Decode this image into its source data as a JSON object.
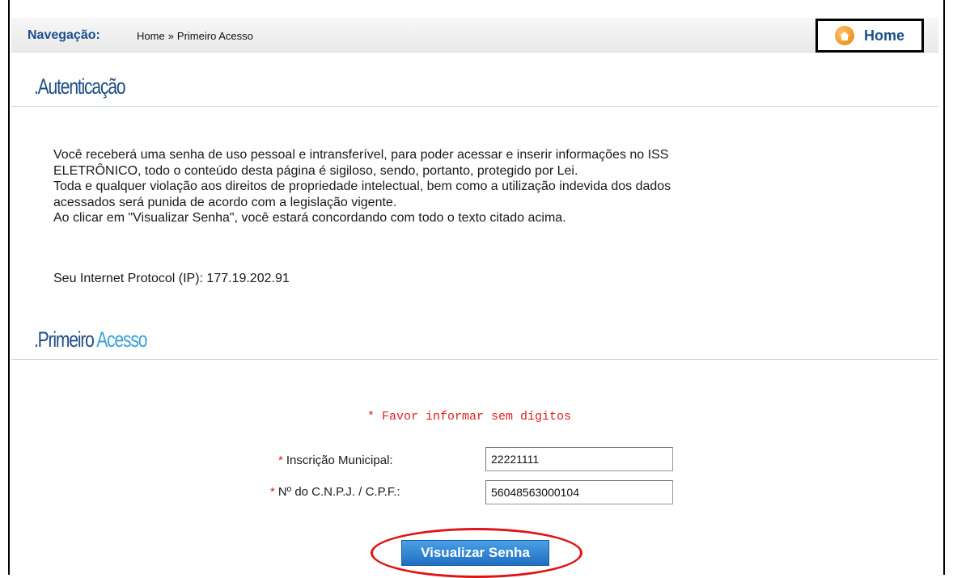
{
  "navigation": {
    "label": "Navegação:",
    "crumbs": [
      "Home",
      "Primeiro Acesso"
    ],
    "separator": "»",
    "home_button_label": "Home"
  },
  "sections": {
    "auth_title": ".Autenticação",
    "first_access_title_part1": ".Primeiro",
    "first_access_title_part2": "Acesso"
  },
  "auth": {
    "lines": [
      "Você receberá uma senha de uso pessoal e intransferível, para poder acessar e inserir informações no ISS",
      "ELETRÔNICO, todo o conteúdo desta página é sigiloso, sendo, portanto, protegido por Lei.",
      "Toda e qualquer violação aos direitos de propriedade intelectual, bem como a utilização indevida dos dados",
      "acessados será punida de acordo com a legislação vigente.",
      "Ao clicar em \"Visualizar Senha\", você estará concordando com todo o texto citado acima."
    ],
    "ip_line": "Seu Internet Protocol (IP): 177.19.202.91"
  },
  "form": {
    "notice": "* Favor informar sem dígitos",
    "required_mark": "*",
    "inscricao_label": "Inscrição Municipal:",
    "inscricao_value": "22221111",
    "cnpj_label": "Nº do C.N.P.J. / C.P.F.:",
    "cnpj_value": "56048563000104",
    "submit_label": "Visualizar Senha"
  },
  "colors": {
    "title_dark": "#1e4e86",
    "title_accent": "#3aa0da",
    "required": "#e02020",
    "button": "#1f6fc2",
    "highlight_ring": "#e01414"
  },
  "icons": {
    "home": "home-icon"
  }
}
